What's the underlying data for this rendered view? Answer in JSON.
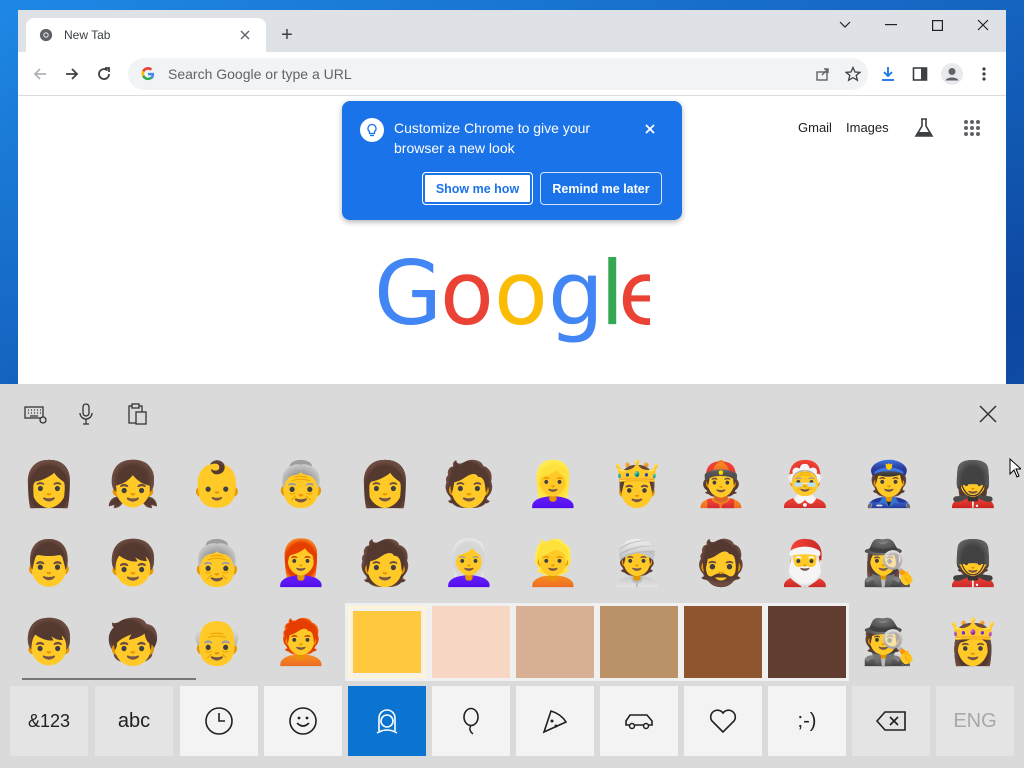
{
  "browser": {
    "tab": {
      "title": "New Tab",
      "close_icon": "close-icon"
    },
    "new_tab_label": "+",
    "window_controls": [
      "chevron-down-icon",
      "minimize-icon",
      "maximize-icon",
      "close-icon"
    ],
    "omnibox": {
      "placeholder": "Search Google or type a URL"
    },
    "ntp_links": {
      "gmail": "Gmail",
      "images": "Images"
    }
  },
  "promo": {
    "text": "Customize Chrome to give your browser a new look",
    "primary_button": "Show me how",
    "secondary_button": "Remind me later",
    "color": "#1a73e8"
  },
  "google_logo": {
    "letters": [
      "G",
      "o",
      "o",
      "g",
      "l",
      "e"
    ],
    "colors": [
      "#4285f4",
      "#ea4335",
      "#fbbc05",
      "#4285f4",
      "#34a853",
      "#ea4335"
    ]
  },
  "keyboard": {
    "top_icons": [
      "keyboard-settings-icon",
      "microphone-icon",
      "clipboard-icon"
    ],
    "emoji_rows": [
      [
        "👩",
        "👧",
        "👶",
        "👵",
        "👩",
        "🧑",
        "👱‍♀️",
        "🤴",
        "👲",
        "🤶",
        "👮",
        "💂‍♀️"
      ],
      [
        "👨",
        "👦",
        "👵",
        "👩‍🦰",
        "🧑",
        "👩‍🦳",
        "👱",
        "👳",
        "🧔",
        "🎅",
        "🕵️‍♀️",
        "💂"
      ],
      [
        "👦",
        "🧒",
        "👴",
        "🧑‍🦰",
        "",
        "",
        "",
        "",
        "",
        "",
        "🕵️",
        "👸"
      ]
    ],
    "skin_tones": [
      "#ffc83d",
      "#f7d7c4",
      "#d8b094",
      "#bb9167",
      "#8e562e",
      "#613d30"
    ],
    "selected_skin_tone_index": 0,
    "bottom_keys": {
      "symbols": "&123",
      "letters": "abc",
      "recent": "clock-icon",
      "smileys": "smiley-icon",
      "people": "person-icon",
      "celebration": "balloon-icon",
      "food": "pizza-icon",
      "travel": "car-icon",
      "symbols_emoji": "heart-icon",
      "emoticons": ";-)",
      "backspace": "backspace-icon",
      "language": "ENG"
    },
    "active_category": "people",
    "accent_color": "#0a74d0"
  }
}
